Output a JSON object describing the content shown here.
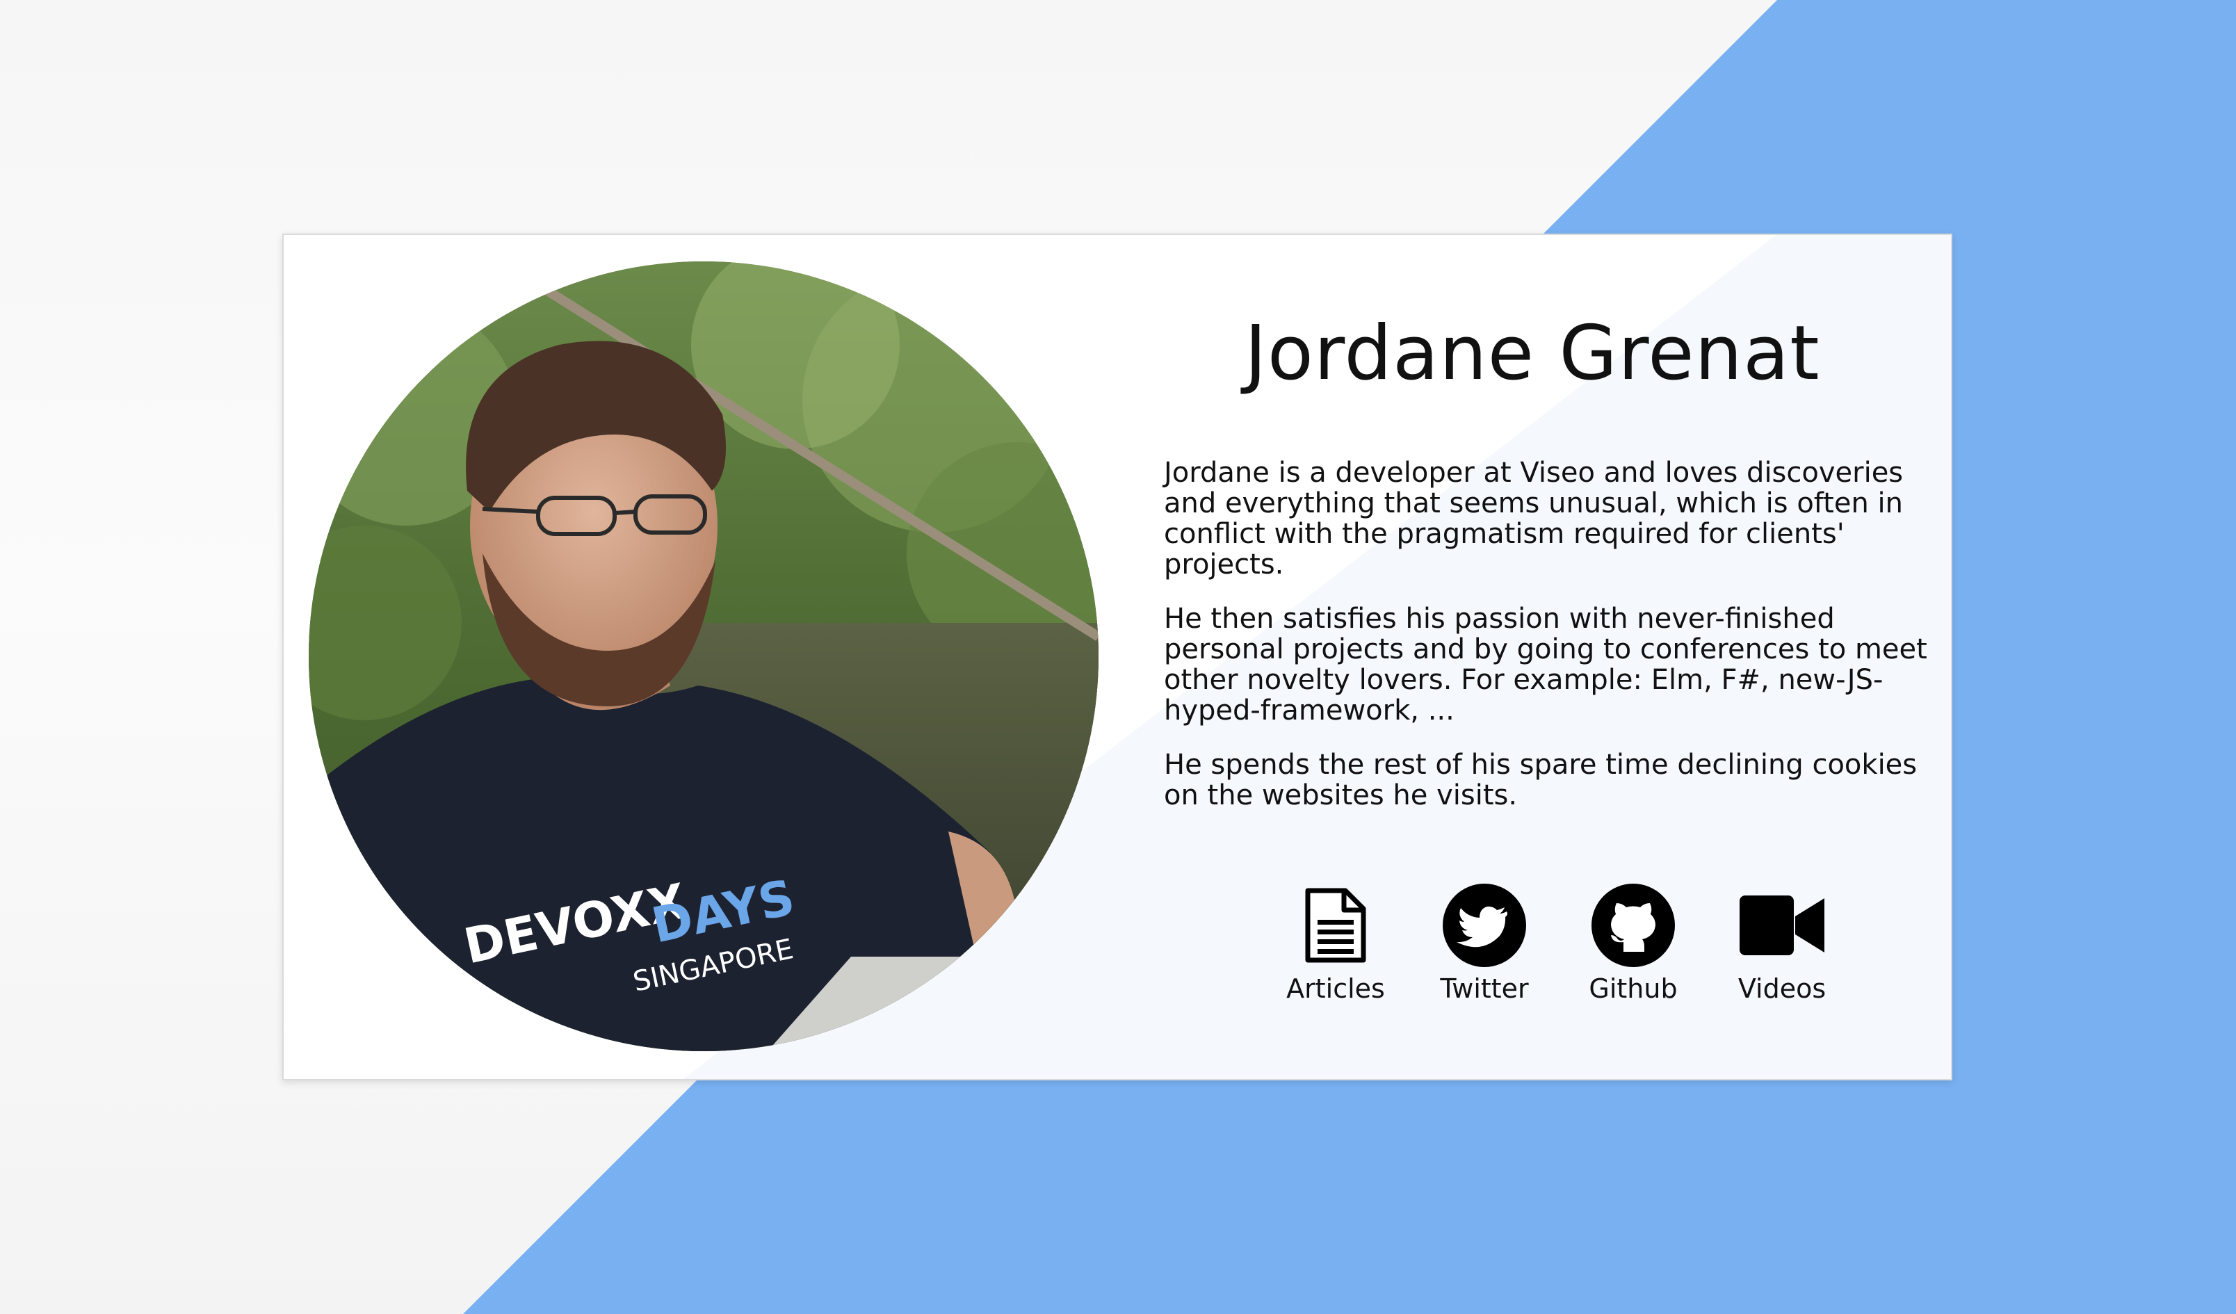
{
  "profile": {
    "name": "Jordane Grenat",
    "bio": [
      "Jordane is a developer at Viseo and loves discoveries and everything that seems unusual, which is often in conflict with the pragmatism required for clients' projects.",
      "He then satisfies his passion with never-finished personal projects and by going to conferences to meet other novelty lovers. For example: Elm, F#, new-JS-hyped-framework, ...",
      "He spends the rest of his spare time declining cookies on the websites he visits."
    ],
    "photo_shirt_text": [
      "DEVOXX",
      "DAYS",
      "SINGAPORE"
    ]
  },
  "links": [
    {
      "label": "Articles",
      "icon": "document-icon"
    },
    {
      "label": "Twitter",
      "icon": "twitter-icon"
    },
    {
      "label": "Github",
      "icon": "github-icon"
    },
    {
      "label": "Videos",
      "icon": "video-camera-icon"
    }
  ],
  "colors": {
    "accent_blue": "#78b0f2",
    "card_background": "#ffffff",
    "text": "#111111",
    "page_background": "#f6f6f6"
  }
}
